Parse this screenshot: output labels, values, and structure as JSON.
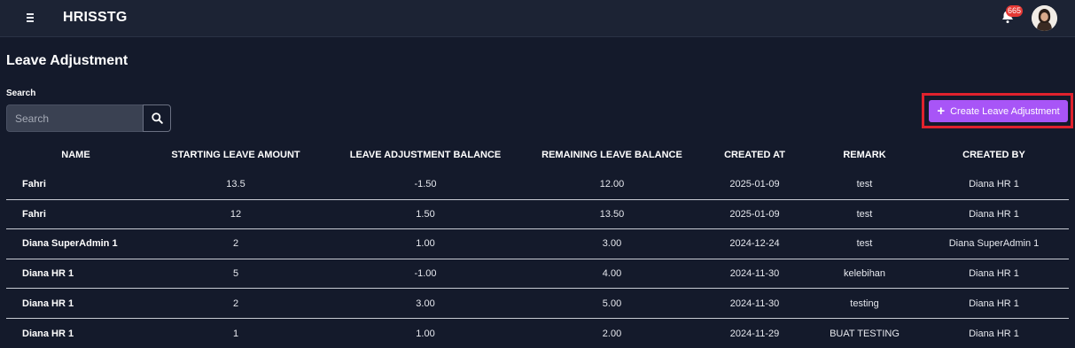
{
  "app": {
    "title": "HRISSTG"
  },
  "header": {
    "notification_count": "665"
  },
  "page": {
    "title": "Leave Adjustment"
  },
  "search": {
    "label": "Search",
    "placeholder": "Search",
    "value": ""
  },
  "actions": {
    "create_label": "Create Leave Adjustment"
  },
  "table": {
    "columns": [
      "NAME",
      "STARTING LEAVE AMOUNT",
      "LEAVE ADJUSTMENT BALANCE",
      "REMAINING LEAVE BALANCE",
      "CREATED AT",
      "REMARK",
      "CREATED BY"
    ],
    "rows": [
      [
        "Fahri",
        "13.5",
        "-1.50",
        "12.00",
        "2025-01-09",
        "test",
        "Diana HR 1"
      ],
      [
        "Fahri",
        "12",
        "1.50",
        "13.50",
        "2025-01-09",
        "test",
        "Diana HR 1"
      ],
      [
        "Diana SuperAdmin 1",
        "2",
        "1.00",
        "3.00",
        "2024-12-24",
        "test",
        "Diana SuperAdmin 1"
      ],
      [
        "Diana HR 1",
        "5",
        "-1.00",
        "4.00",
        "2024-11-30",
        "kelebihan",
        "Diana HR 1"
      ],
      [
        "Diana HR 1",
        "2",
        "3.00",
        "5.00",
        "2024-11-30",
        "testing",
        "Diana HR 1"
      ],
      [
        "Diana HR 1",
        "1",
        "1.00",
        "2.00",
        "2024-11-29",
        "BUAT TESTING",
        "Diana HR 1"
      ]
    ]
  },
  "colors": {
    "background": "#141a2b",
    "topbar": "#1c2334",
    "accent": "#a855f7",
    "highlight": "#e0222d",
    "badge": "#e53935"
  }
}
